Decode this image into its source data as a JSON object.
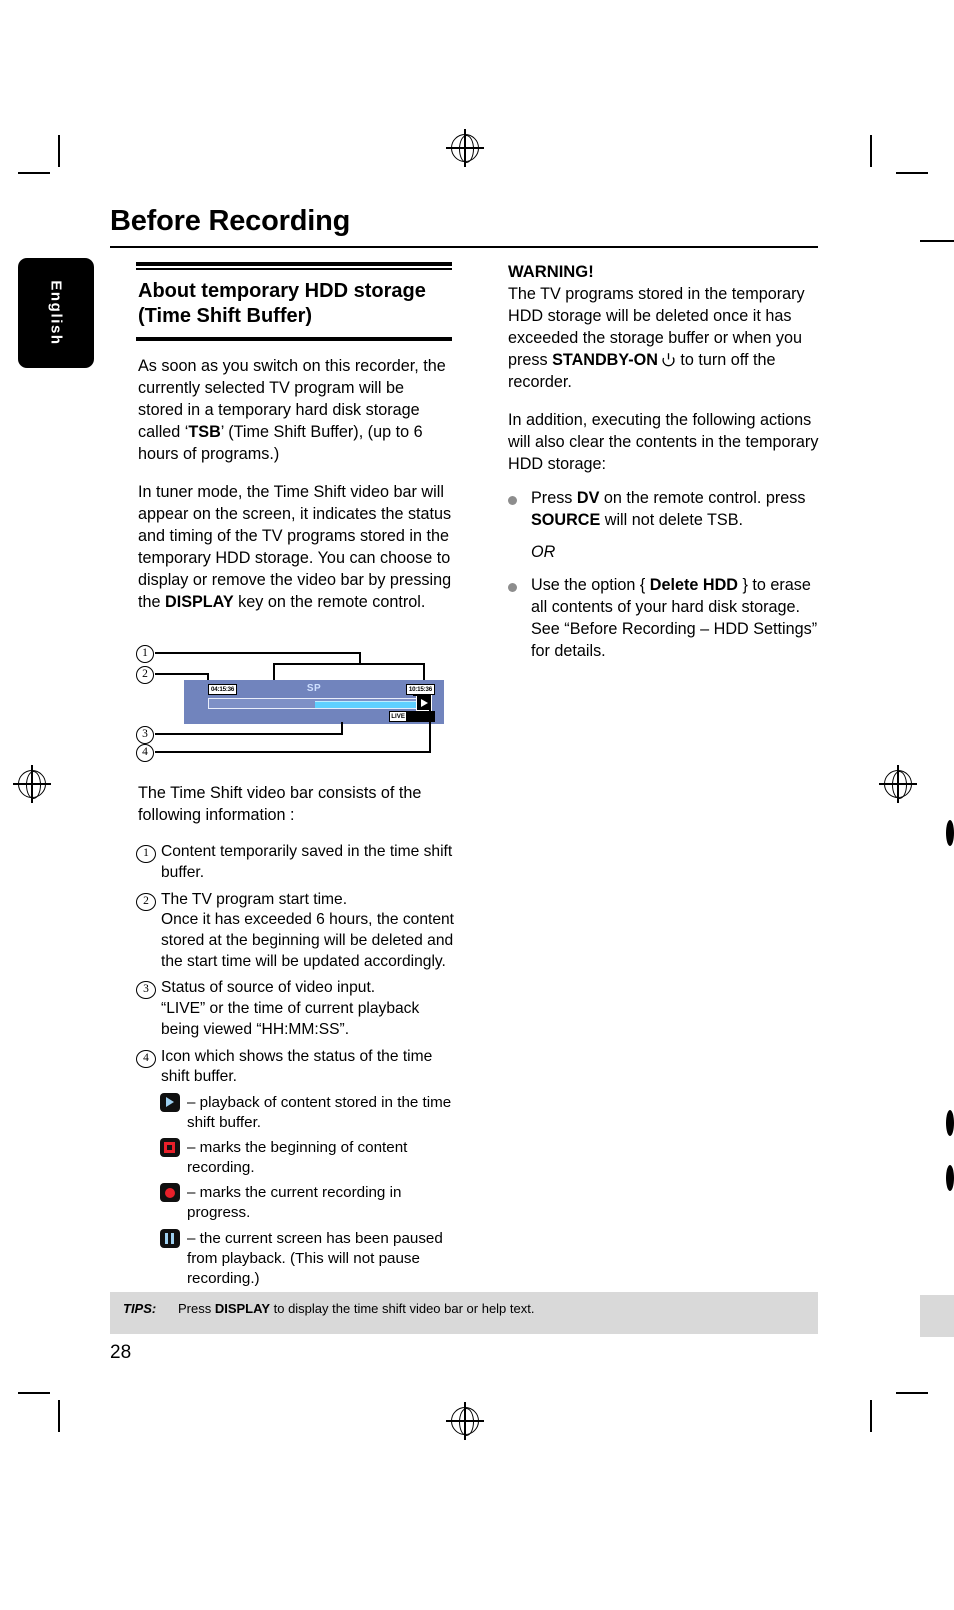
{
  "page": {
    "chapter_title": "Before Recording",
    "language_tab": "English",
    "page_number": "28"
  },
  "left_column": {
    "section_heading": "About temporary HDD storage (Time Shift Buffer)",
    "para_1": "As soon as you switch on this recorder, the currently selected TV program will be stored in a temporary hard disk storage called ‘TSB’ (Time Shift Buffer), (up to 6 hours of programs.)",
    "para_1_bold": "TSB",
    "para_2_a": "In tuner mode, the Time Shift video bar will appear on the screen, it indicates the status and timing of the TV programs stored in the temporary HDD storage. You can choose to display or remove the video bar by pressing the ",
    "para_2_bold": "DISPLAY",
    "para_2_b": " key on the remote control.",
    "list_intro": "The Time Shift video bar consists of the following information :",
    "items": [
      {
        "number": "1",
        "text": "Content temporarily saved in the time shift buffer.",
        "sub": ""
      },
      {
        "number": "2",
        "text": "The TV program start time.",
        "sub": "Once it has exceeded 6 hours, the content stored at the beginning will be deleted and the start time will be updated accordingly."
      },
      {
        "number": "3",
        "text": "Status of source of video input.",
        "sub": "“LIVE” or the time of current playback being viewed “HH:MM:SS”."
      },
      {
        "number": "4",
        "text": "Icon which shows the status of the time shift buffer.",
        "sub": ""
      }
    ],
    "icon_legend": [
      {
        "icon": "play-icon",
        "text": "– playback of content stored in the time shift buffer."
      },
      {
        "icon": "stop-icon",
        "text": "– marks the beginning of content recording."
      },
      {
        "icon": "record-icon",
        "text": "– marks the current recording in progress."
      },
      {
        "icon": "pause-icon",
        "text": "– the current screen has been paused from playback. (This will not pause recording.)"
      }
    ]
  },
  "diagram": {
    "callouts": [
      "1",
      "2",
      "3",
      "4"
    ],
    "video_bar": {
      "start_time": "04:15:36",
      "record_mode": "SP",
      "end_time": "10:15:36",
      "live_label": "LIVE",
      "playhead_icon": "play-icon"
    }
  },
  "right_column": {
    "warning_title": "WARNING!",
    "warning_a": "The TV programs stored in the temporary HDD storage will be deleted once it has exceeded the storage buffer or when you press ",
    "warning_bold": "STANDBY-ON",
    "warning_b": " to turn off the recorder.",
    "para_2": "In addition, executing the following actions will also clear the contents in the temporary HDD storage:",
    "bullets": [
      {
        "pre": "Press ",
        "bold": "DV",
        "mid": " on the remote control. press ",
        "bold2": "SOURCE",
        "post": " will not delete TSB."
      },
      {
        "pre": "Use the option { ",
        "bold": "Delete HDD",
        "mid": " } to erase all contents of your hard disk storage. See “Before Recording – HDD Settings” for details.",
        "bold2": "",
        "post": ""
      }
    ],
    "or_text": "OR"
  },
  "tips": {
    "label": "TIPS:",
    "pre": "Press ",
    "bold": "DISPLAY",
    "post": " to display the time shift video bar or help text."
  },
  "colors": {
    "video_bar_bg": "#7184bd",
    "progress_fill": "#5fd0ff",
    "record_red": "#e8202a",
    "icon_blue": "#9ed0f0",
    "tips_bg": "#d9d9d9"
  }
}
